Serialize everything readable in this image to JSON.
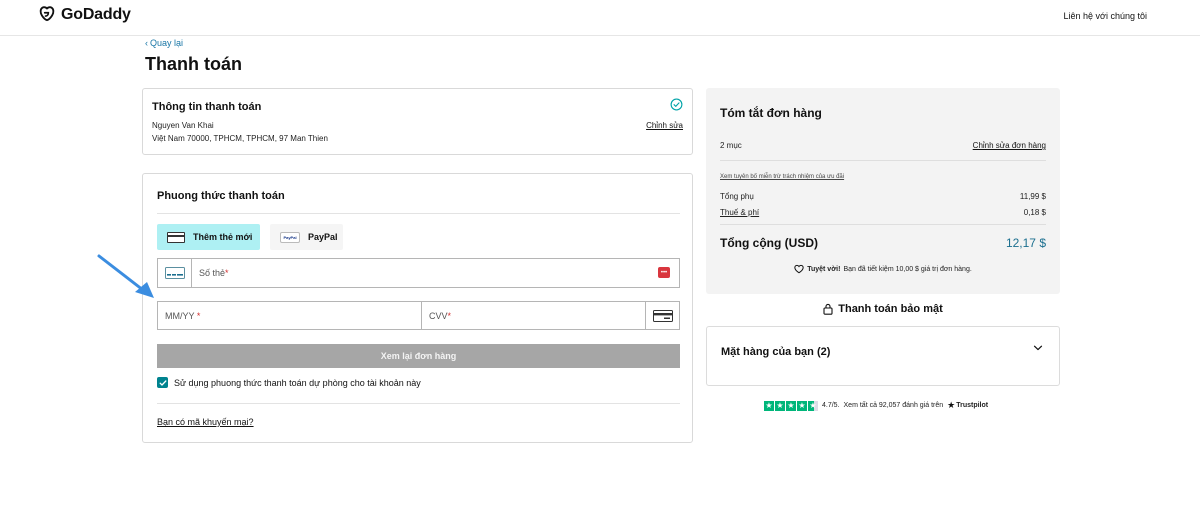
{
  "header": {
    "logo_text": "GoDaddy",
    "contact_label": "Liên hệ với chúng tôi"
  },
  "nav": {
    "back_label": "Quay lại"
  },
  "page": {
    "title": "Thanh toán"
  },
  "billing": {
    "title": "Thông tin thanh toán",
    "name": "Nguyen Van Khai",
    "address": "Việt Nam 70000, TPHCM, TPHCM, 97 Man Thien",
    "edit_label": "Chỉnh sửa"
  },
  "payment": {
    "title": "Phuong thức thanh toán",
    "methods": [
      {
        "label": "Thêm thẻ mới",
        "selected": true
      },
      {
        "label": "PayPal",
        "selected": false,
        "badge": "PayPal"
      }
    ],
    "card_number_label": "Số thẻ",
    "expiry_label": "MM/YY",
    "cvv_label": "CVV",
    "required_mark": "*",
    "card_flag_text": "•••",
    "review_button": "Xem lại đơn hàng",
    "backup_label": "Sử dụng phuong thức thanh toán dự phòng cho tài khoản này",
    "backup_checked": true,
    "promo_link": "Bạn có mã khuyến mại?"
  },
  "summary": {
    "title": "Tóm tắt đơn hàng",
    "items_count": "2 mục",
    "edit_label": "Chỉnh sửa đơn hàng",
    "disclaimer_link": "Xem tuyên bố miễn trừ trách nhiệm của ưu đãi",
    "subtotal_label": "Tổng phụ",
    "subtotal_value": "11,99 $",
    "tax_label": "Thuế & phí",
    "tax_value": "0,18 $",
    "total_label": "Tổng cộng (USD)",
    "total_value": "12,17 $",
    "savings_bold": "Tuyệt vời!",
    "savings_text": "Bạn đã tiết kiệm 10,00 $ giá trị đơn hàng.",
    "accent_color": "#1b6f8f"
  },
  "secure": {
    "label": "Thanh toán bảo mật"
  },
  "items": {
    "title": "Mặt hàng của bạn (2)"
  },
  "rating": {
    "score": "4.7/5.",
    "text": "Xem tất cả 92,057 đánh giá trên",
    "brand": "Trustpilot",
    "stars": 4.7
  }
}
